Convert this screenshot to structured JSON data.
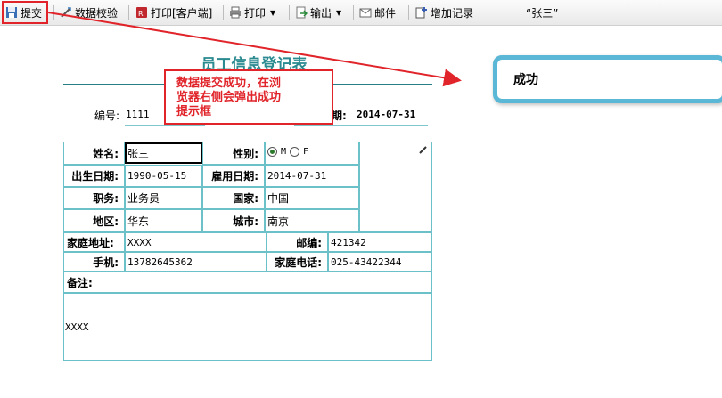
{
  "toolbar": {
    "submit": "提交",
    "validate": "数据校验",
    "print_client": "打印[客户端]",
    "print": "打印",
    "export": "输出",
    "mail": "邮件",
    "add_record": "增加记录",
    "user": "“张三”"
  },
  "form": {
    "title": "员工信息登记表",
    "id_label": "编号:",
    "id_value": "1111",
    "date_label": "期:",
    "date_value": "2014-07-31",
    "name_label": "姓名:",
    "name_value": "张三",
    "gender_label": "性别:",
    "gender_options": [
      "M",
      "F"
    ],
    "gender_selected": "M",
    "birth_label": "出生日期:",
    "birth_value": "1990-05-15",
    "hire_label": "雇用日期:",
    "hire_value": "2014-07-31",
    "position_label": "职务:",
    "position_value": "业务员",
    "country_label": "国家:",
    "country_value": "中国",
    "region_label": "地区:",
    "region_value": "华东",
    "city_label": "城市:",
    "city_value": "南京",
    "address_label": "家庭地址:",
    "address_value": "XXXX",
    "zip_label": "邮编:",
    "zip_value": "421342",
    "mobile_label": "手机:",
    "mobile_value": "13782645362",
    "phone_label": "家庭电话:",
    "phone_value": "025-43422344",
    "notes_label": "备注:",
    "notes_value": "XXXX"
  },
  "annotation": {
    "line1": "数据提交成功，在浏",
    "line2": "览器右侧会弹出成功",
    "line3": "提示框"
  },
  "popup": {
    "message": "成功"
  },
  "colors": {
    "accent_red": "#e0242a",
    "table_border": "#6cc1c9",
    "title_teal": "#2a8a90",
    "popup_border": "#5ab8d6"
  }
}
